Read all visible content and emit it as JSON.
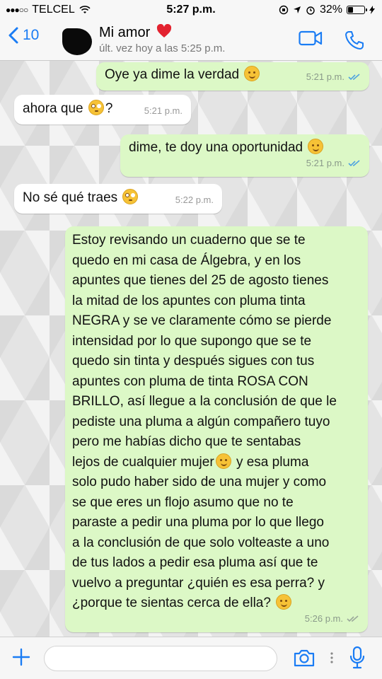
{
  "status_bar": {
    "carrier": "TELCEL",
    "time": "5:27 p.m.",
    "battery_text": "32%",
    "battery_level": 0.32
  },
  "header": {
    "back_count": "10",
    "contact_name": "Mi amor",
    "last_seen": "últ. vez hoy a las 5:25 p.m."
  },
  "messages": [
    {
      "direction": "out",
      "text": "Oye ya dime la verdad",
      "emoji": "smile-emoji",
      "time": "5:21 p.m.",
      "status": "read"
    },
    {
      "direction": "in",
      "text": "ahora que",
      "emoji": "flushed-emoji",
      "suffix": "?",
      "time": "5:21 p.m."
    },
    {
      "direction": "out",
      "text": "dime, te doy una oportunidad",
      "emoji": "smile-emoji",
      "time": "5:21 p.m.",
      "status": "read"
    },
    {
      "direction": "in",
      "text": "No sé qué traes",
      "emoji": "flushed-emoji",
      "time": "5:22 p.m."
    },
    {
      "direction": "out",
      "text_part1": "Estoy revisando un cuaderno que se te\nquedo en mi casa de Álgebra, y en los\napuntes que tienes del 25 de agosto tienes\nla mitad de los apuntes con pluma tinta\nNEGRA y se ve claramente cómo se pierde\nintensidad por lo que supongo que se te\nquedo sin tinta y después sigues con tus\napuntes con pluma de tinta ROSA CON\nBRILLO, así llegue a la conclusión de que le\npediste una pluma a algún compañero tuyo\npero me habías dicho que te sentabas\nlejos de cualquier mujer",
      "text_part2": " y esa pluma\nsolo pudo haber sido de una mujer y como\nse que eres un flojo asumo que no te\nparaste a pedir una pluma por lo que llego\na la conclusión de que solo volteaste a uno\nde tus lados a pedir esa pluma así que te\nvuelvo a preguntar ¿quién es esa perra? y\n¿porque te sientas cerca de ella?",
      "emoji": "smile-emoji",
      "time": "5:26 p.m.",
      "status": "delivered"
    }
  ],
  "input": {
    "placeholder": ""
  },
  "colors": {
    "accent": "#1a7cf4",
    "outgoing_bubble": "#dcf8c6",
    "incoming_bubble": "#ffffff",
    "read_tick": "#4fa3e0",
    "delivered_tick": "#9aa89a"
  }
}
